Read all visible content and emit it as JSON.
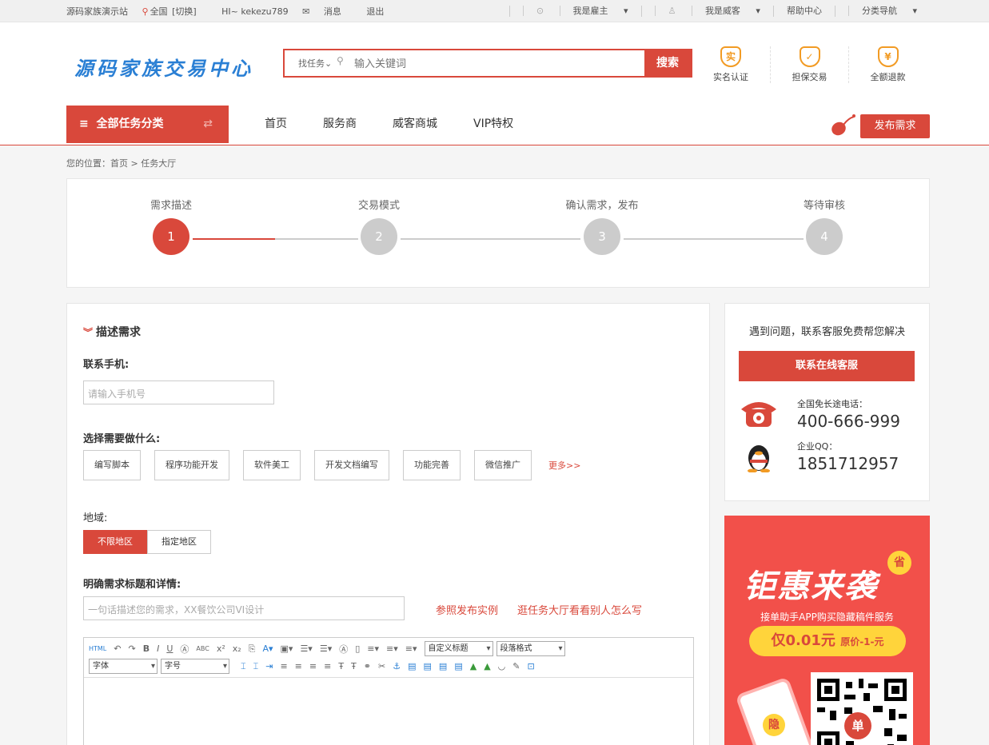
{
  "topbar": {
    "site_name": "源码家族演示站",
    "region": "全国",
    "switch": "[切换]",
    "greeting": "HI~ kekezu789",
    "messages": "消息",
    "logout": "退出",
    "employer": "我是雇主",
    "worker": "我是威客",
    "help": "帮助中心",
    "category_nav": "分类导航"
  },
  "header": {
    "logo_text": "源码家族交易中心",
    "search_scope": "找任务",
    "search_placeholder": "输入关键词",
    "search_button": "搜索",
    "badges": [
      {
        "icon": "实",
        "label": "实名认证"
      },
      {
        "icon": "✓",
        "label": "担保交易"
      },
      {
        "icon": "¥",
        "label": "全额退款"
      }
    ]
  },
  "nav": {
    "all_categories": "全部任务分类",
    "items": [
      "首页",
      "服务商",
      "威客商城",
      "VIP特权"
    ],
    "publish": "发布需求"
  },
  "breadcrumb": "您的位置：首页 > 任务大厅",
  "steps": [
    {
      "title": "需求描述",
      "num": "1"
    },
    {
      "title": "交易模式",
      "num": "2"
    },
    {
      "title": "确认需求，发布",
      "num": "3"
    },
    {
      "title": "等待审核",
      "num": "4"
    }
  ],
  "form": {
    "section_title": "描述需求",
    "phone_label": "联系手机:",
    "phone_placeholder": "请输入手机号",
    "need_label": "选择需要做什么:",
    "options": [
      "编写脚本",
      "程序功能开发",
      "软件美工",
      "开发文档编写",
      "功能完善",
      "微信推广"
    ],
    "more": "更多>>",
    "region_label": "地域:",
    "region_options": [
      "不限地区",
      "指定地区"
    ],
    "title_label": "明确需求标题和详情:",
    "title_placeholder": "一句话描述您的需求，XX餐饮公司VI设计",
    "example_link": "参照发布实例",
    "hall_link": "逛任务大厅看看别人怎么写",
    "editor": {
      "custom_title": "自定义标题",
      "para_format": "段落格式",
      "font": "字体",
      "size": "字号"
    }
  },
  "sidebar": {
    "question": "遇到问题，联系客服免费帮您解决",
    "cs_button": "联系在线客服",
    "hotline_label": "全国免长途电话：",
    "hotline": "400-666-999",
    "qq_label": "企业QQ：",
    "qq": "1851712957"
  },
  "ad": {
    "headline": "钜惠来袭",
    "save": "省",
    "sub": "接单助手APP购买隐藏稿件服务",
    "price": "仅0.01元",
    "orig": "原价-1-元",
    "hidden": "隐",
    "order": "单"
  },
  "colors": {
    "accent": "#d9483b",
    "logo": "#2a7fd4",
    "badge": "#f29b24"
  }
}
